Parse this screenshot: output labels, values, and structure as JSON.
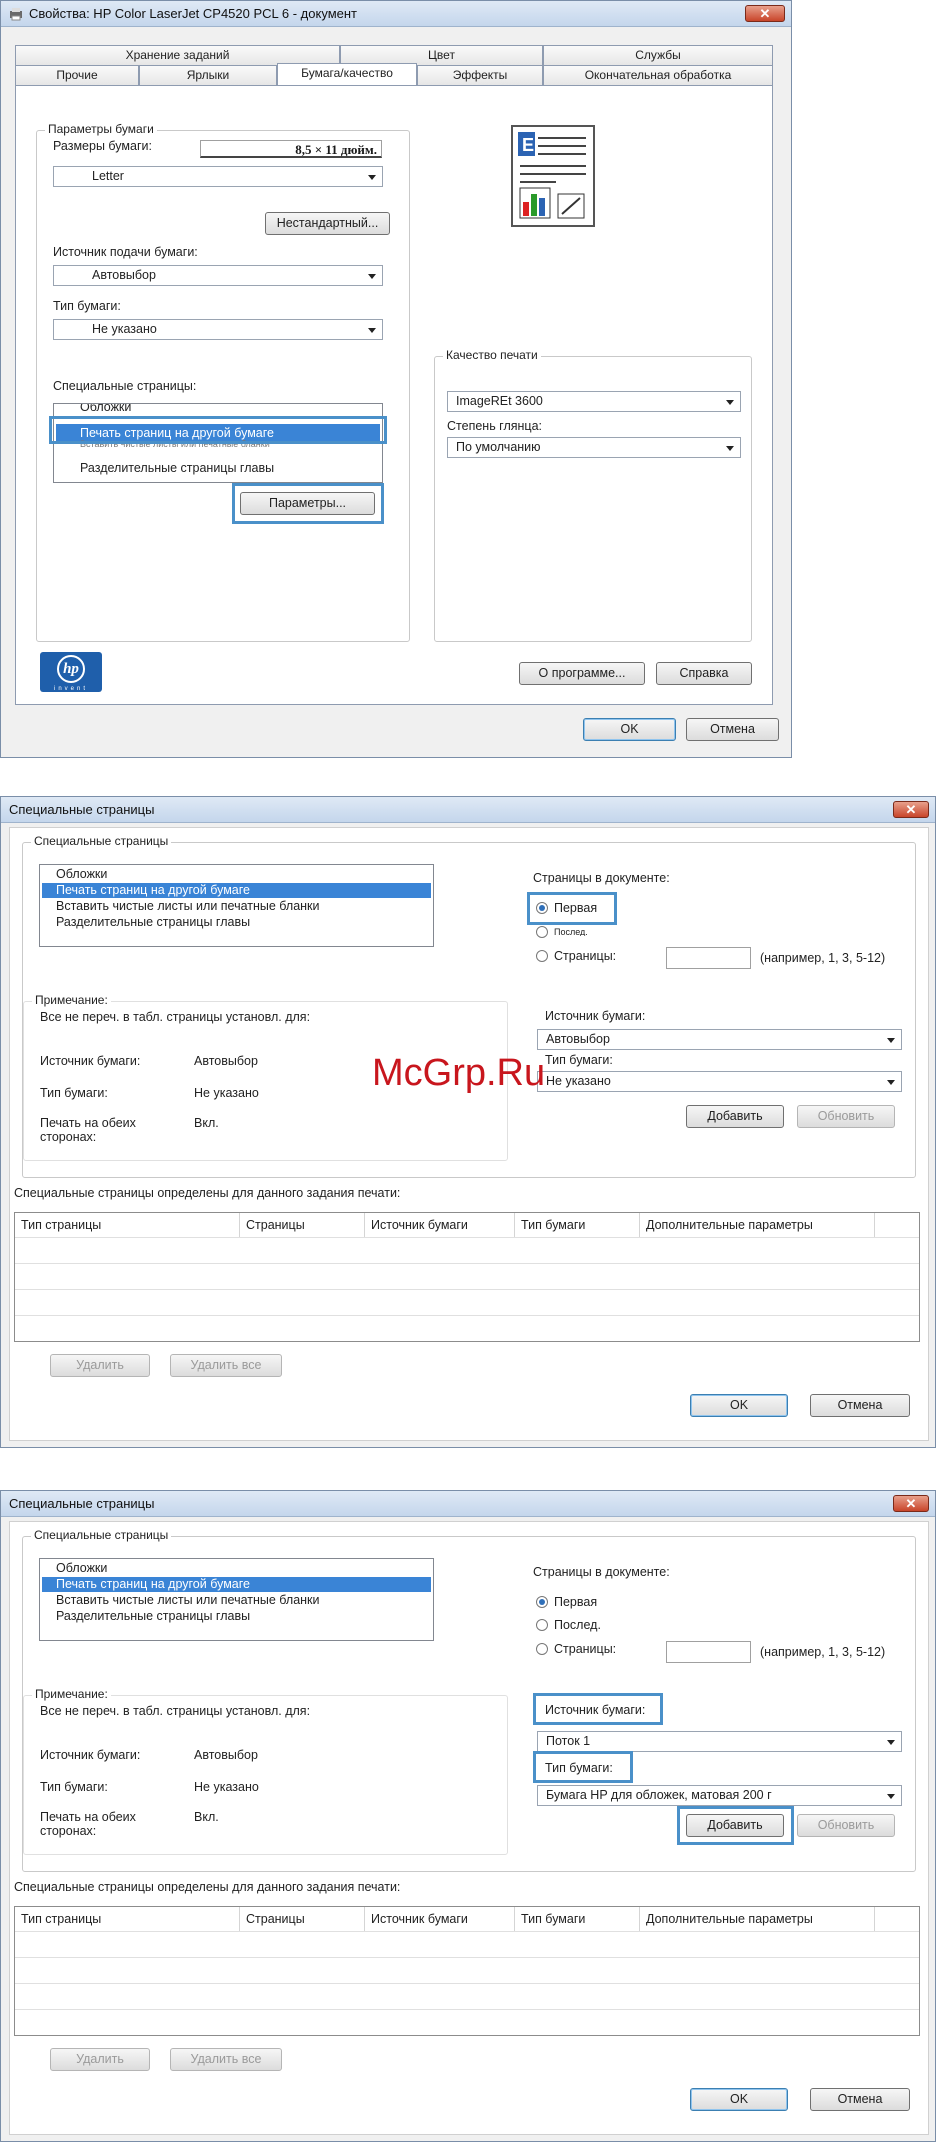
{
  "watermark": "McGrp.Ru",
  "dialog1": {
    "title": "Свойства: HP Color LaserJet CP4520 PCL 6 - документ",
    "close": "✕",
    "tabs_back": [
      "Хранение заданий",
      "Цвет",
      "Службы"
    ],
    "tabs_front": [
      "Прочие",
      "Ярлыки",
      "Бумага/качество",
      "Эффекты",
      "Окончательная обработка"
    ],
    "active_tab": "Бумага/качество",
    "paper_group": "Параметры бумаги",
    "paper_size_label": "Размеры бумаги:",
    "paper_size_value": "8,5 × 11 дюйм.",
    "paper_combo": "Letter",
    "custom_button": "Нестандартный...",
    "source_label": "Источник подачи бумаги:",
    "source_value": "Автовыбор",
    "type_label": "Тип бумаги:",
    "type_value": "Не указано",
    "special_label": "Специальные страницы:",
    "special_items": [
      "Обложки",
      "Печать страниц на другой бумаге",
      "Вставить чистые листы или печатные бланки",
      "Разделительные страницы главы"
    ],
    "params_button": "Параметры...",
    "quality_group": "Качество печати",
    "quality_value": "ImageREt 3600",
    "gloss_label": "Степень глянца:",
    "gloss_value": "По умолчанию",
    "about_button": "О программе...",
    "help_button": "Справка",
    "ok": "OK",
    "cancel": "Отмена",
    "logo_sub": "invent",
    "logo_mark": "hp",
    "preview_letter": "E"
  },
  "dialog2": {
    "title": "Специальные страницы",
    "close": "✕",
    "group": "Специальные страницы",
    "items": [
      "Обложки",
      "Печать страниц на другой бумаге",
      "Вставить чистые листы или печатные бланки",
      "Разделительные страницы главы"
    ],
    "pages_label": "Страницы в документе:",
    "radio_first": "Первая",
    "radio_last": "Послед.",
    "radio_pages": "Страницы:",
    "pages_hint": "(например, 1, 3, 5-12)",
    "note_group": "Примечание:",
    "note_text": "Все не переч. в  табл. страницы установл. для:",
    "src_label": "Источник бумаги:",
    "src_value": "Автовыбор",
    "type_label": "Тип бумаги:",
    "type_value": "Не указано",
    "duplex_label": "Печать на обеих сторонах:",
    "duplex_value": "Вкл.",
    "r_src_label": "Источник бумаги:",
    "r_src_value": "Автовыбор",
    "r_type_label": "Тип бумаги:",
    "r_type_value": "Не указано",
    "add": "Добавить",
    "update": "Обновить",
    "defined_label": "Специальные страницы определены для данного задания печати:",
    "columns": [
      "Тип страницы",
      "Страницы",
      "Источник бумаги",
      "Тип бумаги",
      "Дополнительные параметры"
    ],
    "delete": "Удалить",
    "delete_all": "Удалить все",
    "ok": "OK",
    "cancel": "Отмена"
  },
  "dialog3": {
    "title": "Специальные страницы",
    "close": "✕",
    "group": "Специальные страницы",
    "items": [
      "Обложки",
      "Печать страниц на другой бумаге",
      "Вставить чистые листы или печатные бланки",
      "Разделительные страницы главы"
    ],
    "pages_label": "Страницы в документе:",
    "radio_first": "Первая",
    "radio_last": "Послед.",
    "radio_pages": "Страницы:",
    "pages_hint": "(например, 1, 3, 5-12)",
    "note_group": "Примечание:",
    "note_text": "Все не переч. в  табл. страницы установл. для:",
    "src_label": "Источник бумаги:",
    "src_value": "Автовыбор",
    "type_label": "Тип бумаги:",
    "type_value": "Не указано",
    "duplex_label": "Печать на обеих сторонах:",
    "duplex_value": "Вкл.",
    "r_src_label": "Источник бумаги:",
    "r_src_value": "Поток 1",
    "r_type_label": "Тип бумаги:",
    "r_type_value": "Бумага HP для обложек, матовая 200 г",
    "add": "Добавить",
    "update": "Обновить",
    "defined_label": "Специальные страницы определены для данного задания печати:",
    "columns": [
      "Тип страницы",
      "Страницы",
      "Источник бумаги",
      "Тип бумаги",
      "Дополнительные параметры"
    ],
    "delete": "Удалить",
    "delete_all": "Удалить все",
    "ok": "OK",
    "cancel": "Отмена"
  },
  "colors": {
    "highlight": "#4a90c9",
    "selection": "#3a84d6",
    "hp_blue": "#1f5fab"
  }
}
